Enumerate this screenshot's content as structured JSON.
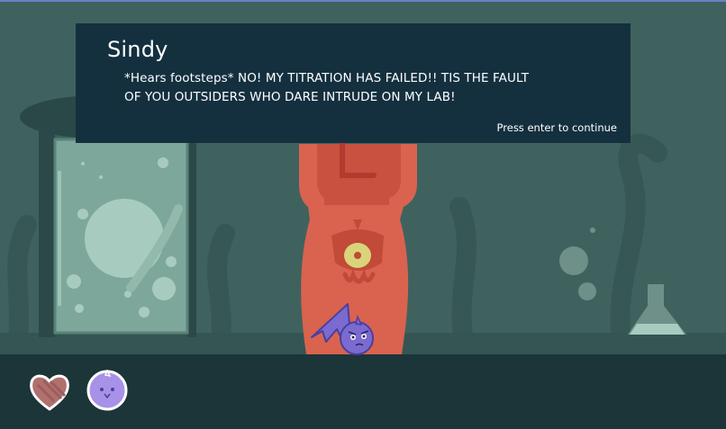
{
  "dialog": {
    "speaker": "Sindy",
    "line_1": "*Hears footsteps* NO! MY TITRATION HAS FAILED!! TIS THE FAULT",
    "line_2": "OF YOU OUTSIDERS WHO DARE INTRUDE ON MY LAB!",
    "continue_prompt": "Press enter to continue"
  },
  "hud": {
    "icons": [
      "heart-icon",
      "bat-companion-icon"
    ]
  },
  "colors": {
    "dialog_bg": "#14303f",
    "wall": "#3f625f",
    "floor": "#1b3538",
    "character_red": "#d9634f",
    "bat_purple": "#7b6bd0"
  }
}
